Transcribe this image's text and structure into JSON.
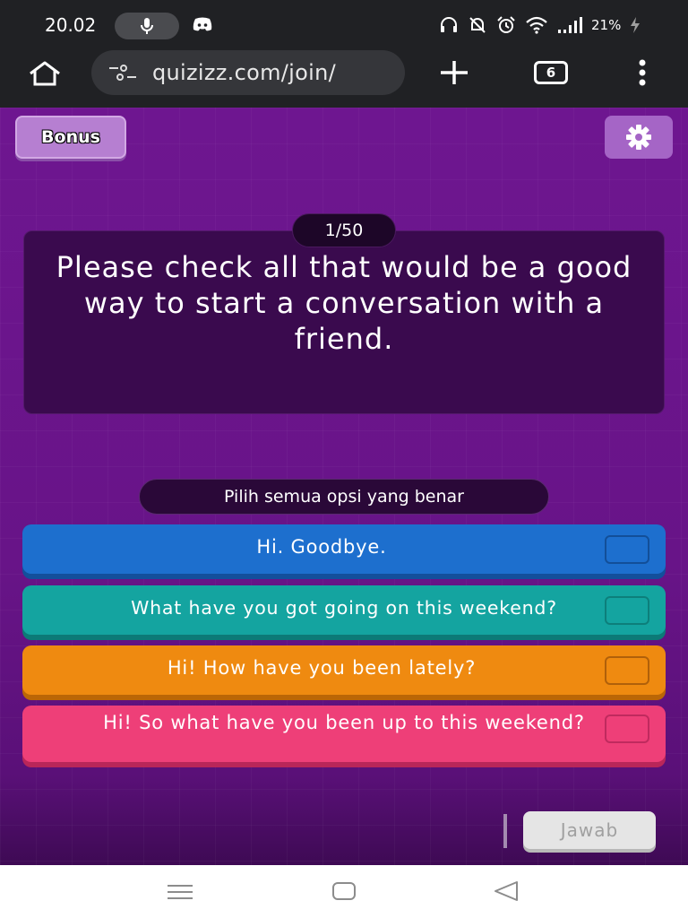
{
  "status_bar": {
    "time": "20.02",
    "battery": "21%",
    "icons": [
      "microphone-icon",
      "discord-icon",
      "headphones-icon",
      "mute-icon",
      "alarm-icon",
      "wifi-icon",
      "signal-icon",
      "charging-icon"
    ]
  },
  "browser": {
    "url": "quizizz.com/join/",
    "tab_count": "6",
    "icons": [
      "home-icon",
      "site-info-icon",
      "new-tab-icon",
      "more-icon"
    ]
  },
  "quiz": {
    "bonus_label": "Bonus",
    "counter": "1/50",
    "question": "Please check all that would be a good way to start a conversation with a friend.",
    "hint": "Pilih semua opsi yang benar",
    "options": [
      {
        "label": "Hi. Goodbye.",
        "color": "#1d6fce"
      },
      {
        "label": "What have you got going on this weekend?",
        "color": "#14a4a0"
      },
      {
        "label": "Hi! How have you been lately?",
        "color": "#ef8a10"
      },
      {
        "label": "Hi! So what have you been up to this weekend?",
        "color": "#ee3f78"
      }
    ],
    "submit_label": "Jawab"
  },
  "colors": {
    "background": "#6e1690",
    "card": "#3a0a4e"
  }
}
